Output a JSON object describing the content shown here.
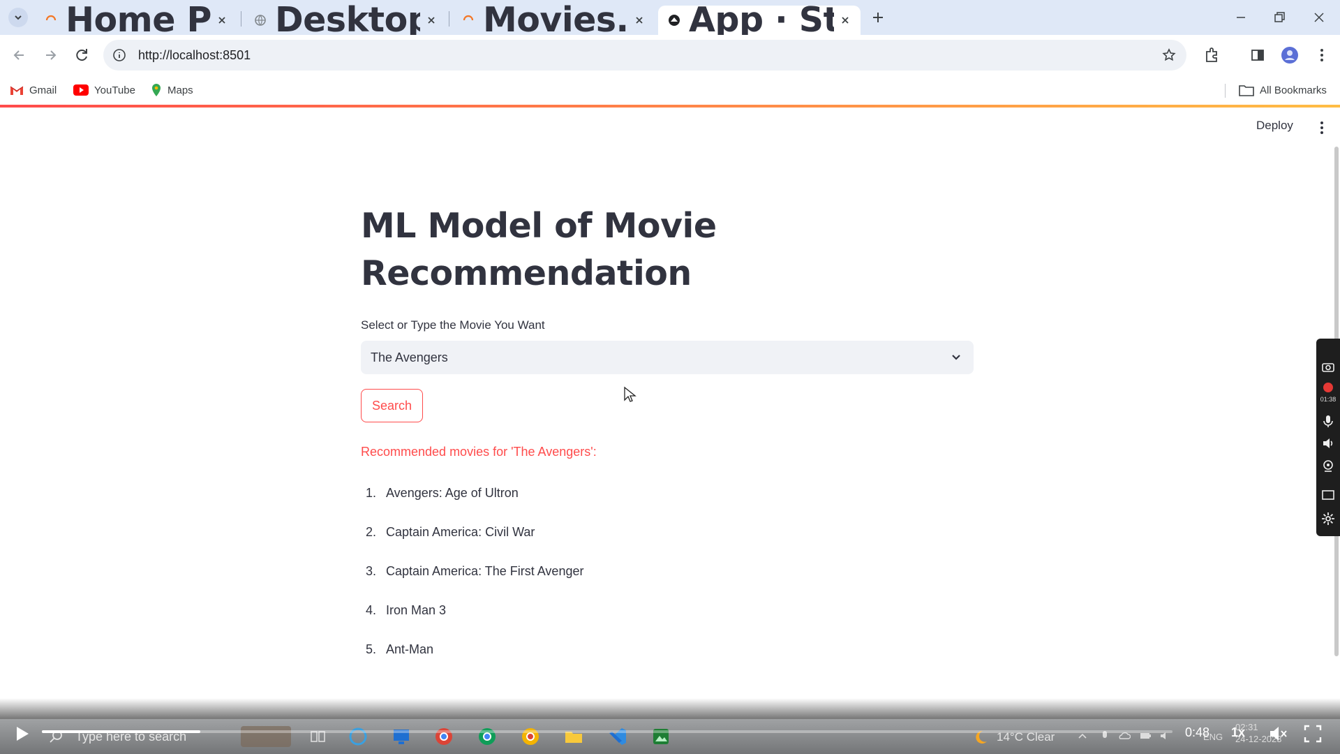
{
  "browser": {
    "tabs": [
      {
        "title": "Home Page - Select or create a",
        "favicon": "jupyter-icon",
        "active": false
      },
      {
        "title": "Desktop/ML/",
        "favicon": "globe-icon",
        "active": false
      },
      {
        "title": "Movies.ipynb - JupyterLab",
        "favicon": "jupyter-icon",
        "active": false
      },
      {
        "title": "App · Streamlit",
        "favicon": "streamlit-icon",
        "active": true
      }
    ],
    "url": "http://localhost:8501",
    "bookmarks": [
      {
        "label": "Gmail",
        "icon": "gmail-icon"
      },
      {
        "label": "YouTube",
        "icon": "youtube-icon"
      },
      {
        "label": "Maps",
        "icon": "maps-icon"
      }
    ],
    "all_bookmarks": "All Bookmarks"
  },
  "app": {
    "deploy_label": "Deploy",
    "title_line1": "ML Model of Movie",
    "title_line2": "Recommendation",
    "select_label": "Select or Type the Movie You Want",
    "selected_movie": "The Avengers",
    "search_button": "Search",
    "recommend_heading": "Recommended movies for 'The Avengers':",
    "recommendations": [
      {
        "num": "1.",
        "title": "Avengers: Age of Ultron"
      },
      {
        "num": "2.",
        "title": "Captain America: Civil War"
      },
      {
        "num": "3.",
        "title": "Captain America: The First Avenger"
      },
      {
        "num": "4.",
        "title": "Iron Man 3"
      },
      {
        "num": "5.",
        "title": "Ant-Man"
      }
    ],
    "accent_color": "#ff4b4b"
  },
  "recorder": {
    "timer": "01:38"
  },
  "taskbar": {
    "search_placeholder": "Type here to search",
    "weather": "14°C  Clear",
    "language": "ENG",
    "time": "02:31",
    "date": "24-12-2023"
  },
  "player": {
    "time": "0:48",
    "speed": "1x",
    "progress": 0.14
  }
}
